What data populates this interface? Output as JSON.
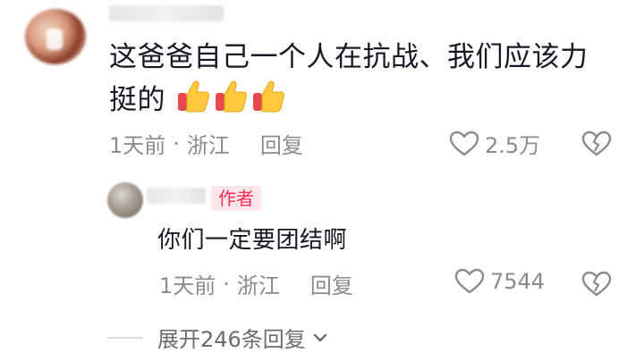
{
  "comment": {
    "text": "这爸爸自己一个人在抗战、我们应该力挺的",
    "emoji_icon": "thumbs-up-emoji",
    "emoji_count": 3,
    "time": "1天前",
    "separator": "·",
    "location": "浙江",
    "reply_label": "回复",
    "likes": "2.5万"
  },
  "reply": {
    "author_badge": "作者",
    "text": "你们一定要团结啊",
    "time": "1天前",
    "separator": "·",
    "location": "浙江",
    "reply_label": "回复",
    "likes": "7544"
  },
  "expand_replies": {
    "label": "展开246条回复",
    "icon": "chevron-down-icon"
  },
  "colors": {
    "accent": "#fe2c55",
    "meta_text": "#8a8b91",
    "primary_text": "#161823"
  }
}
